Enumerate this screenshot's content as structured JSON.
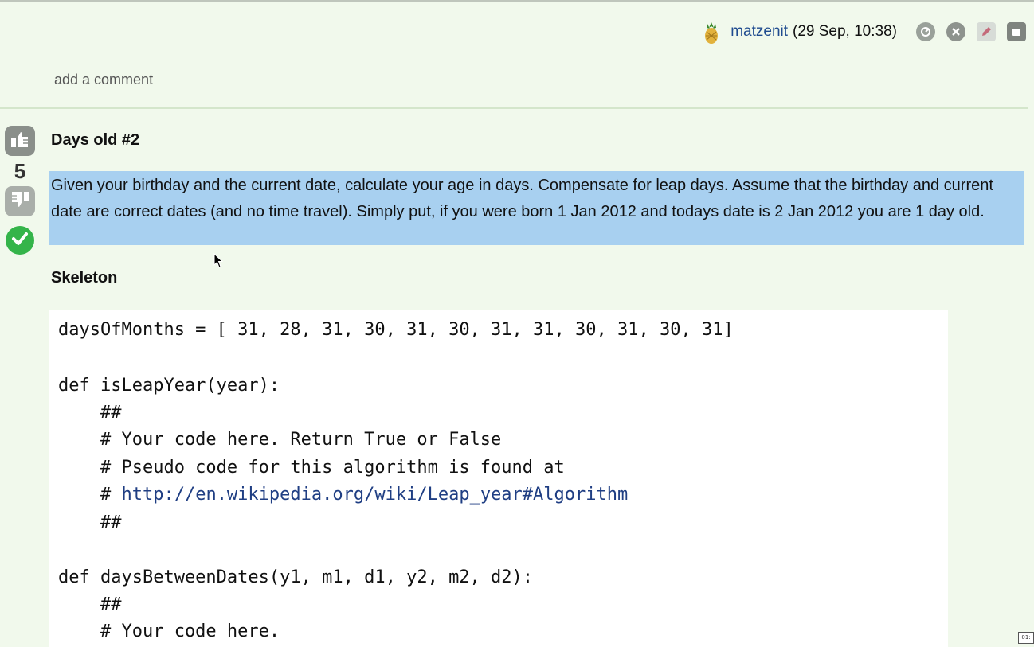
{
  "author": {
    "name": "matzenit",
    "time": "(29 Sep, 10:38)"
  },
  "comments": {
    "add_label": "add a comment"
  },
  "post": {
    "votes": "5",
    "title": "Days old #2",
    "question": "Given your birthday and the current date, calculate your age in days. Compensate for leap days. Assume that the birthday and current date are correct dates (and no time travel). Simply put, if you were born 1 Jan 2012 and todays date is 2 Jan 2012 you are 1 day old.",
    "skeleton_heading": "Skeleton"
  },
  "code": {
    "line1": "daysOfMonths = [ 31, 28, 31, 30, 31, 30, 31, 31, 30, 31, 30, 31]",
    "line2": "def isLeapYear(year):",
    "line3": "    ##",
    "line4": "    # Your code here. Return True or False",
    "line5": "    # Pseudo code for this algorithm is found at",
    "line6_prefix": "    # ",
    "line6_link": "http://en.wikipedia.org/wiki/Leap_year#Algorithm",
    "line7": "    ##",
    "line8": "def daysBetweenDates(y1, m1, d1, y2, m2, d2):",
    "line9": "    ##",
    "line10": "    # Your code here."
  },
  "badge": "01:",
  "icons": {
    "avatar": "pineapple-avatar",
    "actions": [
      "retag-icon",
      "close-icon",
      "edit-icon",
      "copy-icon"
    ],
    "vote_up": "thumbs-up-icon",
    "vote_down": "thumbs-down-icon",
    "accepted": "checkmark-icon"
  },
  "colors": {
    "background": "#f1f9ec",
    "highlight": "#a8d0f0",
    "link": "#1f4b8f",
    "accept": "#34b44a"
  }
}
